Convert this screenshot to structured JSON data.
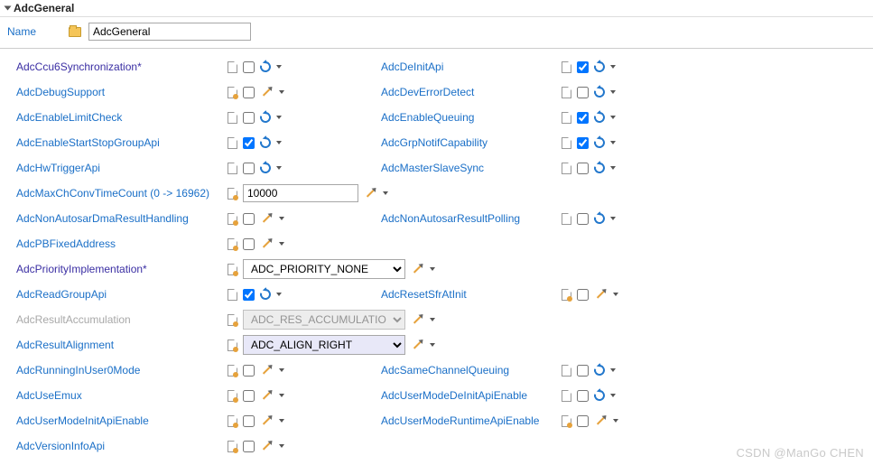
{
  "header": {
    "title": "AdcGeneral"
  },
  "name": {
    "label": "Name",
    "value": "AdcGeneral"
  },
  "rows": [
    {
      "left": {
        "label": "AdcCcu6Synchronization*",
        "modified": true,
        "doc": "plain",
        "checked": false,
        "action": "refresh"
      },
      "right": {
        "label": "AdcDeInitApi",
        "doc": "plain",
        "checked": true,
        "action": "refresh"
      }
    },
    {
      "left": {
        "label": "AdcDebugSupport",
        "doc": "badge",
        "checked": false,
        "action": "pencil"
      },
      "right": {
        "label": "AdcDevErrorDetect",
        "doc": "plain",
        "checked": false,
        "action": "refresh"
      }
    },
    {
      "left": {
        "label": "AdcEnableLimitCheck",
        "doc": "plain",
        "checked": false,
        "action": "refresh"
      },
      "right": {
        "label": "AdcEnableQueuing",
        "doc": "plain",
        "checked": true,
        "action": "refresh"
      }
    },
    {
      "left": {
        "label": "AdcEnableStartStopGroupApi",
        "doc": "plain",
        "checked": true,
        "action": "refresh"
      },
      "right": {
        "label": "AdcGrpNotifCapability",
        "doc": "plain",
        "checked": true,
        "action": "refresh"
      }
    },
    {
      "left": {
        "label": "AdcHwTriggerApi",
        "doc": "plain",
        "checked": false,
        "action": "refresh"
      },
      "right": {
        "label": "AdcMasterSlaveSync",
        "doc": "plain",
        "checked": false,
        "action": "refresh"
      }
    },
    {
      "left": {
        "label": "AdcMaxChConvTimeCount (0 -> 16962)",
        "doc": "badge",
        "type": "text",
        "value": "10000",
        "action": "pencil"
      }
    },
    {
      "left": {
        "label": "AdcNonAutosarDmaResultHandling",
        "doc": "badge",
        "checked": false,
        "action": "pencil"
      },
      "right": {
        "label": "AdcNonAutosarResultPolling",
        "doc": "plain",
        "checked": false,
        "action": "refresh"
      }
    },
    {
      "left": {
        "label": "AdcPBFixedAddress",
        "doc": "badge",
        "checked": false,
        "action": "pencil"
      }
    },
    {
      "left": {
        "label": "AdcPriorityImplementation*",
        "modified": true,
        "doc": "badge",
        "type": "select",
        "value": "ADC_PRIORITY_NONE",
        "action": "pencil"
      }
    },
    {
      "left": {
        "label": "AdcReadGroupApi",
        "doc": "plain",
        "checked": true,
        "action": "refresh"
      },
      "right": {
        "label": "AdcResetSfrAtInit",
        "doc": "badge",
        "checked": false,
        "action": "pencil"
      }
    },
    {
      "left": {
        "label": "AdcResultAccumulation",
        "disabled": true,
        "doc": "badge",
        "type": "select",
        "value": "ADC_RES_ACCUMULATION_NONE",
        "select_disabled": true,
        "action": "pencil"
      }
    },
    {
      "left": {
        "label": "AdcResultAlignment",
        "doc": "badge",
        "type": "select",
        "value": "ADC_ALIGN_RIGHT",
        "select_highlight": true,
        "action": "pencil"
      }
    },
    {
      "left": {
        "label": "AdcRunningInUser0Mode",
        "doc": "badge",
        "checked": false,
        "action": "pencil"
      },
      "right": {
        "label": "AdcSameChannelQueuing",
        "doc": "plain",
        "checked": false,
        "action": "refresh"
      }
    },
    {
      "left": {
        "label": "AdcUseEmux",
        "doc": "badge",
        "checked": false,
        "action": "pencil"
      },
      "right": {
        "label": "AdcUserModeDeInitApiEnable",
        "doc": "plain",
        "checked": false,
        "action": "refresh"
      }
    },
    {
      "left": {
        "label": "AdcUserModeInitApiEnable",
        "doc": "badge",
        "checked": false,
        "action": "pencil"
      },
      "right": {
        "label": "AdcUserModeRuntimeApiEnable",
        "doc": "badge",
        "checked": false,
        "action": "pencil"
      }
    },
    {
      "left": {
        "label": "AdcVersionInfoApi",
        "doc": "badge",
        "checked": false,
        "action": "pencil"
      }
    }
  ],
  "watermark": "CSDN @ManGo CHEN"
}
